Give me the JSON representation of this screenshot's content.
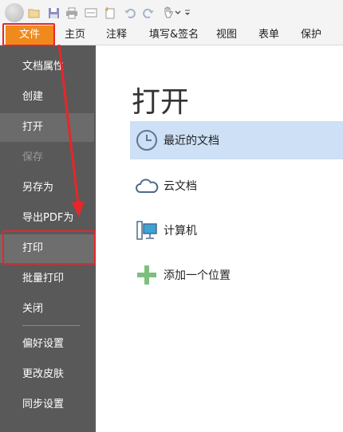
{
  "quick_access": {
    "icons": [
      "app-button-icon",
      "open-folder-icon",
      "save-icon",
      "print-icon",
      "scan-icon",
      "new-icon",
      "undo-icon",
      "redo-icon",
      "hand-tool-icon",
      "dropdown-icon",
      "customize-icon"
    ]
  },
  "tabs": [
    {
      "label": "文件"
    },
    {
      "label": "主页"
    },
    {
      "label": "注释"
    },
    {
      "label": "填写&签名"
    },
    {
      "label": "视图"
    },
    {
      "label": "表单"
    },
    {
      "label": "保护"
    }
  ],
  "menu": {
    "items": [
      {
        "label": "文档属性"
      },
      {
        "label": "创建"
      },
      {
        "label": "打开"
      },
      {
        "label": "保存"
      },
      {
        "label": "另存为"
      },
      {
        "label": "导出PDF为"
      },
      {
        "label": "打印"
      },
      {
        "label": "批量打印"
      },
      {
        "label": "关闭"
      },
      {
        "label": "偏好设置"
      },
      {
        "label": "更改皮肤"
      },
      {
        "label": "同步设置"
      }
    ]
  },
  "panel": {
    "title": "打开",
    "items": [
      {
        "label": "最近的文档",
        "icon": "clock-icon"
      },
      {
        "label": "云文档",
        "icon": "cloud-icon"
      },
      {
        "label": "计算机",
        "icon": "computer-icon"
      },
      {
        "label": "添加一个位置",
        "icon": "plus-icon"
      }
    ]
  },
  "colors": {
    "accent": "#f08a1d",
    "menu_bg": "#595959",
    "selection": "#cde0f5",
    "annotation": "#e8262a"
  }
}
